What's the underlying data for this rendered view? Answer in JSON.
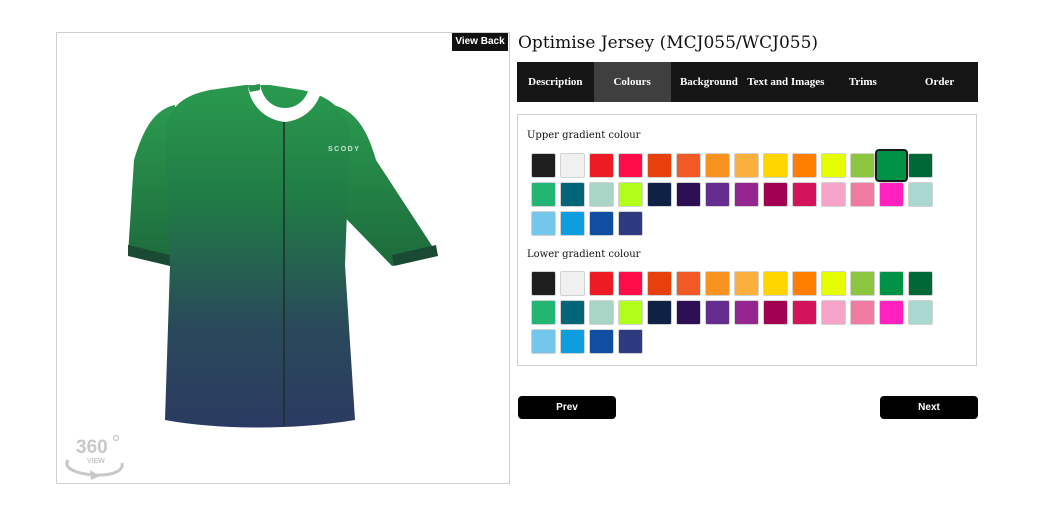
{
  "product": {
    "title": "Optimise Jersey (MCJ055/WCJ055)"
  },
  "preview": {
    "view_back_label": "View Back",
    "brand_text": "SCODY",
    "view360_number": "360",
    "view360_label": "VIEW"
  },
  "tabs": [
    {
      "label": "Description",
      "active": false
    },
    {
      "label": "Colours",
      "active": true
    },
    {
      "label": "Background",
      "active": false
    },
    {
      "label": "Text and Images",
      "active": false
    },
    {
      "label": "Trims",
      "active": false
    },
    {
      "label": "Order",
      "active": false
    }
  ],
  "upper_gradient": {
    "label": "Upper gradient colour",
    "selected_color": "#009245",
    "swatches": [
      "#1e1e1e",
      "#f0f0f0",
      "#ed1c24",
      "#ff0d4b",
      "#e8400c",
      "#f15a24",
      "#f7931e",
      "#fbb03b",
      "#ffd500",
      "#ff7e00",
      "#e6ff00",
      "#8cc63f",
      "#009245",
      "#006837",
      "#22b573",
      "#006577",
      "#a8d5c5",
      "#b2ff1a",
      "#0f2144",
      "#2e0f55",
      "#662d91",
      "#93278f",
      "#a0004f",
      "#d4145a",
      "#f6a3c9",
      "#f07aa0",
      "#ff20c0",
      "#a8d8d0",
      "#73c7ea",
      "#0d9ee0",
      "#0f4ea0",
      "#2e3a80"
    ]
  },
  "lower_gradient": {
    "label": "Lower gradient colour",
    "selected_color": null,
    "swatches": [
      "#1e1e1e",
      "#f0f0f0",
      "#ed1c24",
      "#ff0d4b",
      "#e8400c",
      "#f15a24",
      "#f7931e",
      "#fbb03b",
      "#ffd500",
      "#ff7e00",
      "#e6ff00",
      "#8cc63f",
      "#009245",
      "#006837",
      "#22b573",
      "#006577",
      "#a8d5c5",
      "#b2ff1a",
      "#0f2144",
      "#2e0f55",
      "#662d91",
      "#93278f",
      "#a0004f",
      "#d4145a",
      "#f6a3c9",
      "#f07aa0",
      "#ff20c0",
      "#a8d8d0",
      "#73c7ea",
      "#0d9ee0",
      "#0f4ea0",
      "#2e3a80"
    ]
  },
  "nav": {
    "prev_label": "Prev",
    "next_label": "Next"
  },
  "colors": {
    "jersey_top": "#2a9a4e",
    "jersey_bottom": "#2b3a5e",
    "tab_bar": "#151515",
    "tab_active": "#3f3f3f"
  }
}
